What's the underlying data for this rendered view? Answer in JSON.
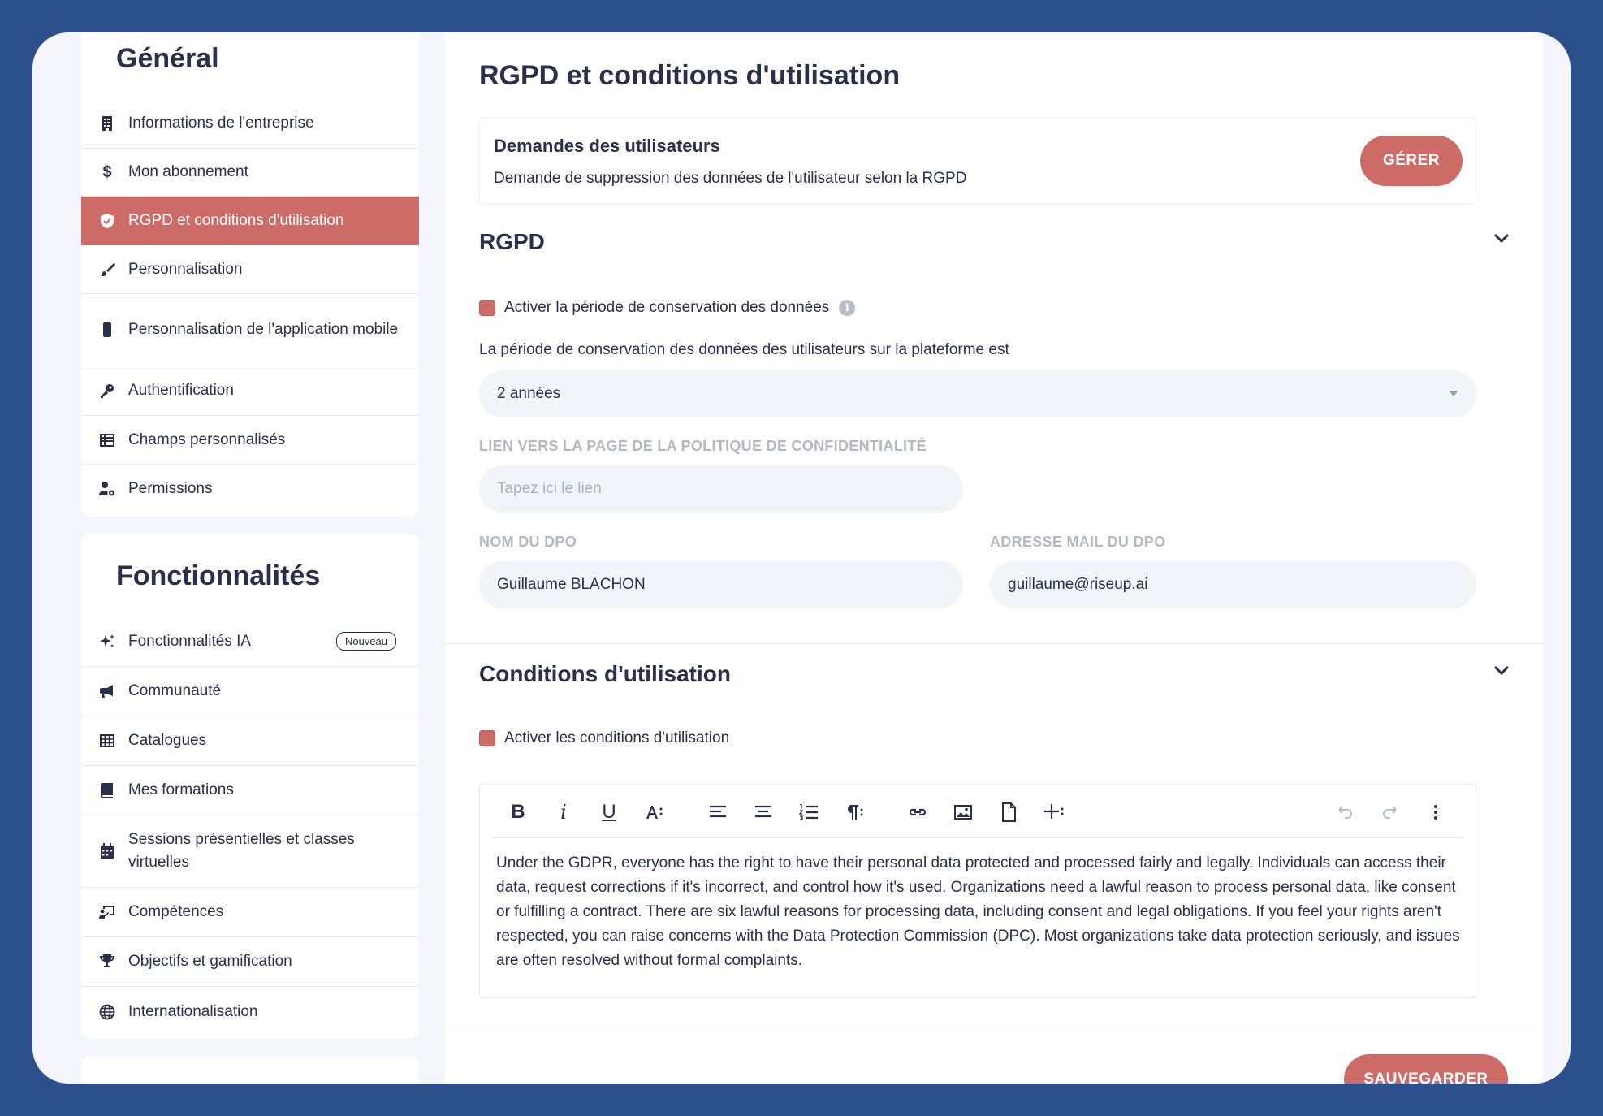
{
  "colors": {
    "accent": "#cd6b66",
    "background": "#2b4f8a",
    "text": "#2a2f4a",
    "muted": "#b3b8c5"
  },
  "sidebar": {
    "general": {
      "title": "Général",
      "items": [
        {
          "label": "Informations de l'entreprise",
          "icon": "building-icon"
        },
        {
          "label": "Mon abonnement",
          "icon": "dollar-icon"
        },
        {
          "label": "RGPD et conditions d'utilisation",
          "icon": "shield-icon",
          "active": true
        },
        {
          "label": "Personnalisation",
          "icon": "brush-icon"
        },
        {
          "label": "Personnalisation de l'application mobile",
          "icon": "mobile-icon"
        },
        {
          "label": "Authentification",
          "icon": "key-icon"
        },
        {
          "label": "Champs personnalisés",
          "icon": "table-list-icon"
        },
        {
          "label": "Permissions",
          "icon": "user-gear-icon"
        }
      ]
    },
    "features": {
      "title": "Fonctionnalités",
      "items": [
        {
          "label": "Fonctionnalités IA",
          "icon": "sparkles-icon",
          "badge": "Nouveau"
        },
        {
          "label": "Communauté",
          "icon": "megaphone-icon"
        },
        {
          "label": "Catalogues",
          "icon": "grid-icon"
        },
        {
          "label": "Mes formations",
          "icon": "book-icon"
        },
        {
          "label": "Sessions présentielles et classes virtuelles",
          "icon": "calendar-icon"
        },
        {
          "label": "Compétences",
          "icon": "chalkboard-user-icon"
        },
        {
          "label": "Objectifs et gamification",
          "icon": "trophy-icon"
        },
        {
          "label": "Internationalisation",
          "icon": "globe-icon"
        }
      ]
    }
  },
  "main": {
    "title": "RGPD et conditions d'utilisation",
    "requests": {
      "title": "Demandes des utilisateurs",
      "description": "Demande de suppression des données de l'utilisateur selon la RGPD",
      "button": "GÉRER"
    },
    "rgpd": {
      "title": "RGPD",
      "retention_checkbox": "Activer la période de conservation des données",
      "retention_text": "La période de conservation des données des utilisateurs sur la plateforme est",
      "retention_value": "2 années",
      "policy_label": "LIEN VERS LA PAGE DE LA POLITIQUE DE CONFIDENTIALITÉ",
      "policy_placeholder": "Tapez ici le lien",
      "dpo_name_label": "NOM DU DPO",
      "dpo_name_value": "Guillaume BLACHON",
      "dpo_email_label": "ADRESSE MAIL DU DPO",
      "dpo_email_value": "guillaume@riseup.ai"
    },
    "terms": {
      "title": "Conditions d'utilisation",
      "checkbox": "Activer les conditions d'utilisation",
      "toolbar": {
        "bold": "B",
        "italic": "i",
        "underline": "U"
      },
      "content": "Under the GDPR, everyone has the right to have their personal data protected and processed fairly and legally. Individuals can access their data, request corrections if it's incorrect, and control how it's used. Organizations need a lawful reason to process personal data, like consent or fulfilling a contract. There are six lawful reasons for processing data, including consent and legal obligations. If you feel your rights aren't respected, you can raise concerns with the Data Protection Commission (DPC). Most organizations take data protection seriously, and issues are often resolved without formal complaints."
    },
    "save_button": "SAUVEGARDER"
  }
}
